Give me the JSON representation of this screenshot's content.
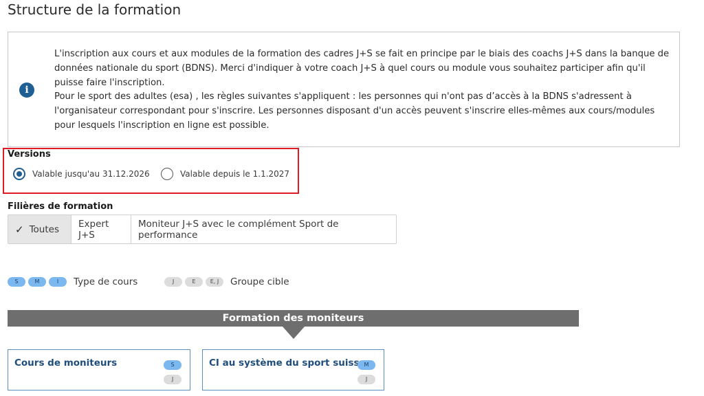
{
  "page": {
    "title": "Structure de la formation"
  },
  "info": {
    "icon": "info-icon",
    "paragraph1": "L'inscription aux cours et aux modules de la formation des cadres J+S se fait en principe par le biais des coachs J+S dans la banque de données nationale du sport (BDNS). Merci d'indiquer à votre coach J+S à quel cours ou module vous souhaitez participer afin qu'il puisse faire l'inscription.",
    "paragraph2": "Pour le sport des adultes (esa) , les règles suivantes s'appliquent : les personnes qui n'ont pas d’accès à la BDNS s'adressent à l'organisateur correspondant pour s'inscrire. Les personnes disposant d'un accès peuvent s'inscrire elles-mêmes aux cours/modules pour lesquels l'inscription en ligne est possible."
  },
  "versions": {
    "label": "Versions",
    "options": [
      {
        "label": "Valable jusqu'au 31.12.2026",
        "selected": true
      },
      {
        "label": "Valable depuis le 1.1.2027",
        "selected": false
      }
    ]
  },
  "filieres": {
    "label": "Filières de formation",
    "options": [
      {
        "label": "Toutes",
        "active": true,
        "icon": "check-icon"
      },
      {
        "label": "Expert J+S",
        "active": false
      },
      {
        "label": "Moniteur J+S avec le complément Sport de performance",
        "active": false
      }
    ]
  },
  "legend": {
    "course_type_tags": [
      "S",
      "M",
      "I"
    ],
    "course_type_label": "Type de cours",
    "target_group_tags": [
      "J",
      "E",
      "E, J"
    ],
    "target_group_label": "Groupe cible"
  },
  "section": {
    "banner_title": "Formation des moniteurs"
  },
  "cards": [
    {
      "title": "Cours de moniteurs",
      "type_tag": "S",
      "group_tag": "J"
    },
    {
      "title": "CI au système du sport suisse",
      "type_tag": "M",
      "group_tag": "J"
    }
  ],
  "colors": {
    "accent_blue": "#1f5f94",
    "highlight_red": "#e01a22",
    "pill_blue": "#7cb8f0",
    "pill_grey": "#dcdcdc",
    "banner_grey": "#6e6e6e"
  }
}
